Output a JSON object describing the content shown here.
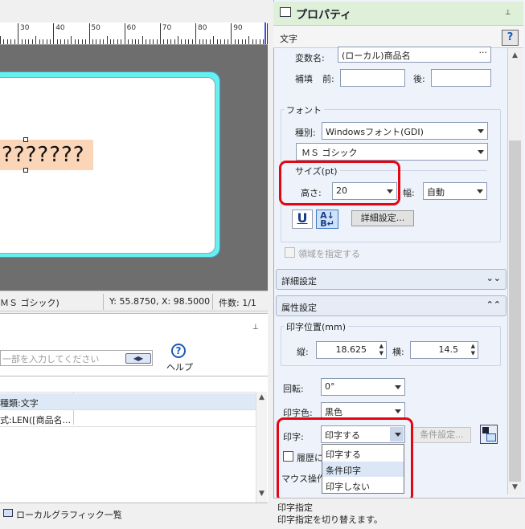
{
  "layout_area": {
    "ruler_numbers": [
      "30",
      "40",
      "50",
      "60",
      "70",
      "80",
      "90"
    ],
    "text_object_value": "???????"
  },
  "status_strip": {
    "font": "ＭＳ ゴシック)",
    "position": "Y: 55.8750, X: 98.5000",
    "count": "件数: 1/1"
  },
  "lower_left": {
    "pin_glyph": "⊥",
    "search_placeholder": "一部を入力してください",
    "help_label": "ヘルプ",
    "rows": [
      {
        "text": "種類:文字"
      },
      {
        "text": "式:LEN([商品名..."
      }
    ],
    "bottom_tab": "ローカルグラフィック一覧"
  },
  "properties": {
    "title": "プロパティ",
    "subtitle": "文字",
    "pin_glyph": "⊥",
    "help": "?",
    "variable_name_label": "変数名:",
    "variable_name_value": "(ローカル)商品名",
    "variable_name_more": "···",
    "complement_label": "補填",
    "before_label": "前:",
    "after_label": "後:",
    "before_value": "",
    "after_value": "",
    "font_group": "フォント",
    "font_type_label": "種別:",
    "font_type_value": "Windowsフォント(GDI)",
    "font_name_value": "ＭＳ ゴシック",
    "size_group": "サイズ(pt)",
    "height_label": "高さ:",
    "height_value": "20",
    "width_label": "幅:",
    "width_value": "自動",
    "underline_glyph": "U",
    "detail_button": "詳細設定...",
    "area_checkbox_label": "領域を指定する",
    "section_detail": "詳細設定",
    "section_attr": "属性設定",
    "print_position_group": "印字位置(mm)",
    "vertical_label": "縦:",
    "vertical_value": "18.625",
    "horizontal_label": "横:",
    "horizontal_value": "14.5",
    "rotation_label": "回転:",
    "rotation_value": "0°",
    "color_label": "印字色:",
    "color_value": "黒色",
    "print_label": "印字:",
    "print_value": "印字する",
    "condition_button": "条件設定...",
    "history_label": "履歴に",
    "mouse_label": "マウス操作",
    "dropdown_options": [
      "印字する",
      "条件印字",
      "印字しない"
    ],
    "highlighted_option": "条件印字"
  },
  "status_bar": {
    "title": "印字指定",
    "description": "印字指定を切り替えます。"
  },
  "colors": {
    "highlight_red": "#e30613",
    "panel_header_green": "#dff0d8",
    "label_cyan": "#66f0f0",
    "text_object_peach": "#fbd5b8"
  }
}
